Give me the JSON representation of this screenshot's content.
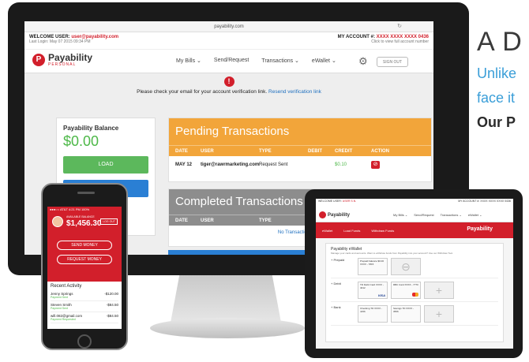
{
  "hero": {
    "title": "A D",
    "line1": "Unlike",
    "line2": "face it",
    "bold": "Our P"
  },
  "monitor": {
    "url": "payability.com",
    "welcome_label": "WELCOME USER: ",
    "welcome_email": "user@payability.com",
    "last_login": "Last Login: May 07 2015 09:34 PM",
    "account_label": "MY ACCOUNT #: ",
    "account_number": "XXXX XXXX XXXX 0436",
    "account_hint": "Click to view full account number",
    "brand": "Payability",
    "brand_sub": "PERSONAL",
    "nav": [
      "My Bills ⌄",
      "Send/Request",
      "Transactions ⌄",
      "eWallet ⌄"
    ],
    "signout": "SIGN OUT",
    "alert_text": "Please check your email for your account verification link. ",
    "alert_link": "Resend verification link",
    "balance_label": "Payability Balance",
    "balance_amount": "$0.00",
    "load_button": "LOAD",
    "withdraw_button": "WITHDRAW",
    "pending": {
      "title": "Pending Transactions",
      "columns": [
        "DATE",
        "USER",
        "TYPE",
        "DEBIT",
        "CREDIT",
        "ACTION"
      ],
      "row": {
        "date": "MAY 12",
        "user": "tiger@rawrmarketing.com",
        "type": "Request Sent",
        "debit": "",
        "credit": "$0.10"
      }
    },
    "completed": {
      "title": "Completed Transactions",
      "columns": [
        "DATE",
        "USER",
        "TYPE",
        "DE"
      ],
      "empty": "No Transactions Avai"
    }
  },
  "phone": {
    "status": "●●●○○ AT&T  4:21 PM  100%",
    "available": "AVAILABLE BALANCE",
    "amount": "$1,456.30",
    "logout": "LOG OUT",
    "send_button": "SEND MONEY",
    "request_button": "REQUEST MONEY",
    "recent_title": "Recent Activity",
    "activity": [
      {
        "name": "Jenny Springs",
        "status": "Payment Sent",
        "amount": "-$120.00"
      },
      {
        "name": "Steven Smith",
        "status": "Payment Sent",
        "amount": "-$84.50"
      },
      {
        "name": "will.082@gmail.com",
        "status": "Payment Requested",
        "amount": "-$84.50"
      }
    ]
  },
  "tablet": {
    "welcome": "WELCOME USER: ",
    "welcome_email": "USER S.N.",
    "account": "MY ACCOUNT #: XXXX XXXX XXXX 0436",
    "brand": "Payability",
    "nav": [
      "My Bills ⌄",
      "Send/Request",
      "Transactions ⌄",
      "eWallet ⌄"
    ],
    "tabs": [
      "eWallet",
      "Load Funds",
      "Withdraw Funds"
    ],
    "sub_brand": "Payability",
    "panel_title": "Payability eWallet",
    "panel_sub": "Manage your cards and accounts. Want to withdraw funds from Payability into your account? Use our Withdraw Tool.",
    "rows": [
      {
        "label": "+ Prepaid",
        "card": "Prepaid balance  $0.00  XXXX - 7815"
      },
      {
        "label": "+ Debit",
        "card": "TD Debit Card  XXXX - 4012",
        "card2": "RBC Card  XXXX - 7770"
      },
      {
        "label": "+ Bank",
        "card": "Checking TD  XXXX - 4156",
        "card2": "Savings TD  XXXX - 3556"
      }
    ]
  }
}
